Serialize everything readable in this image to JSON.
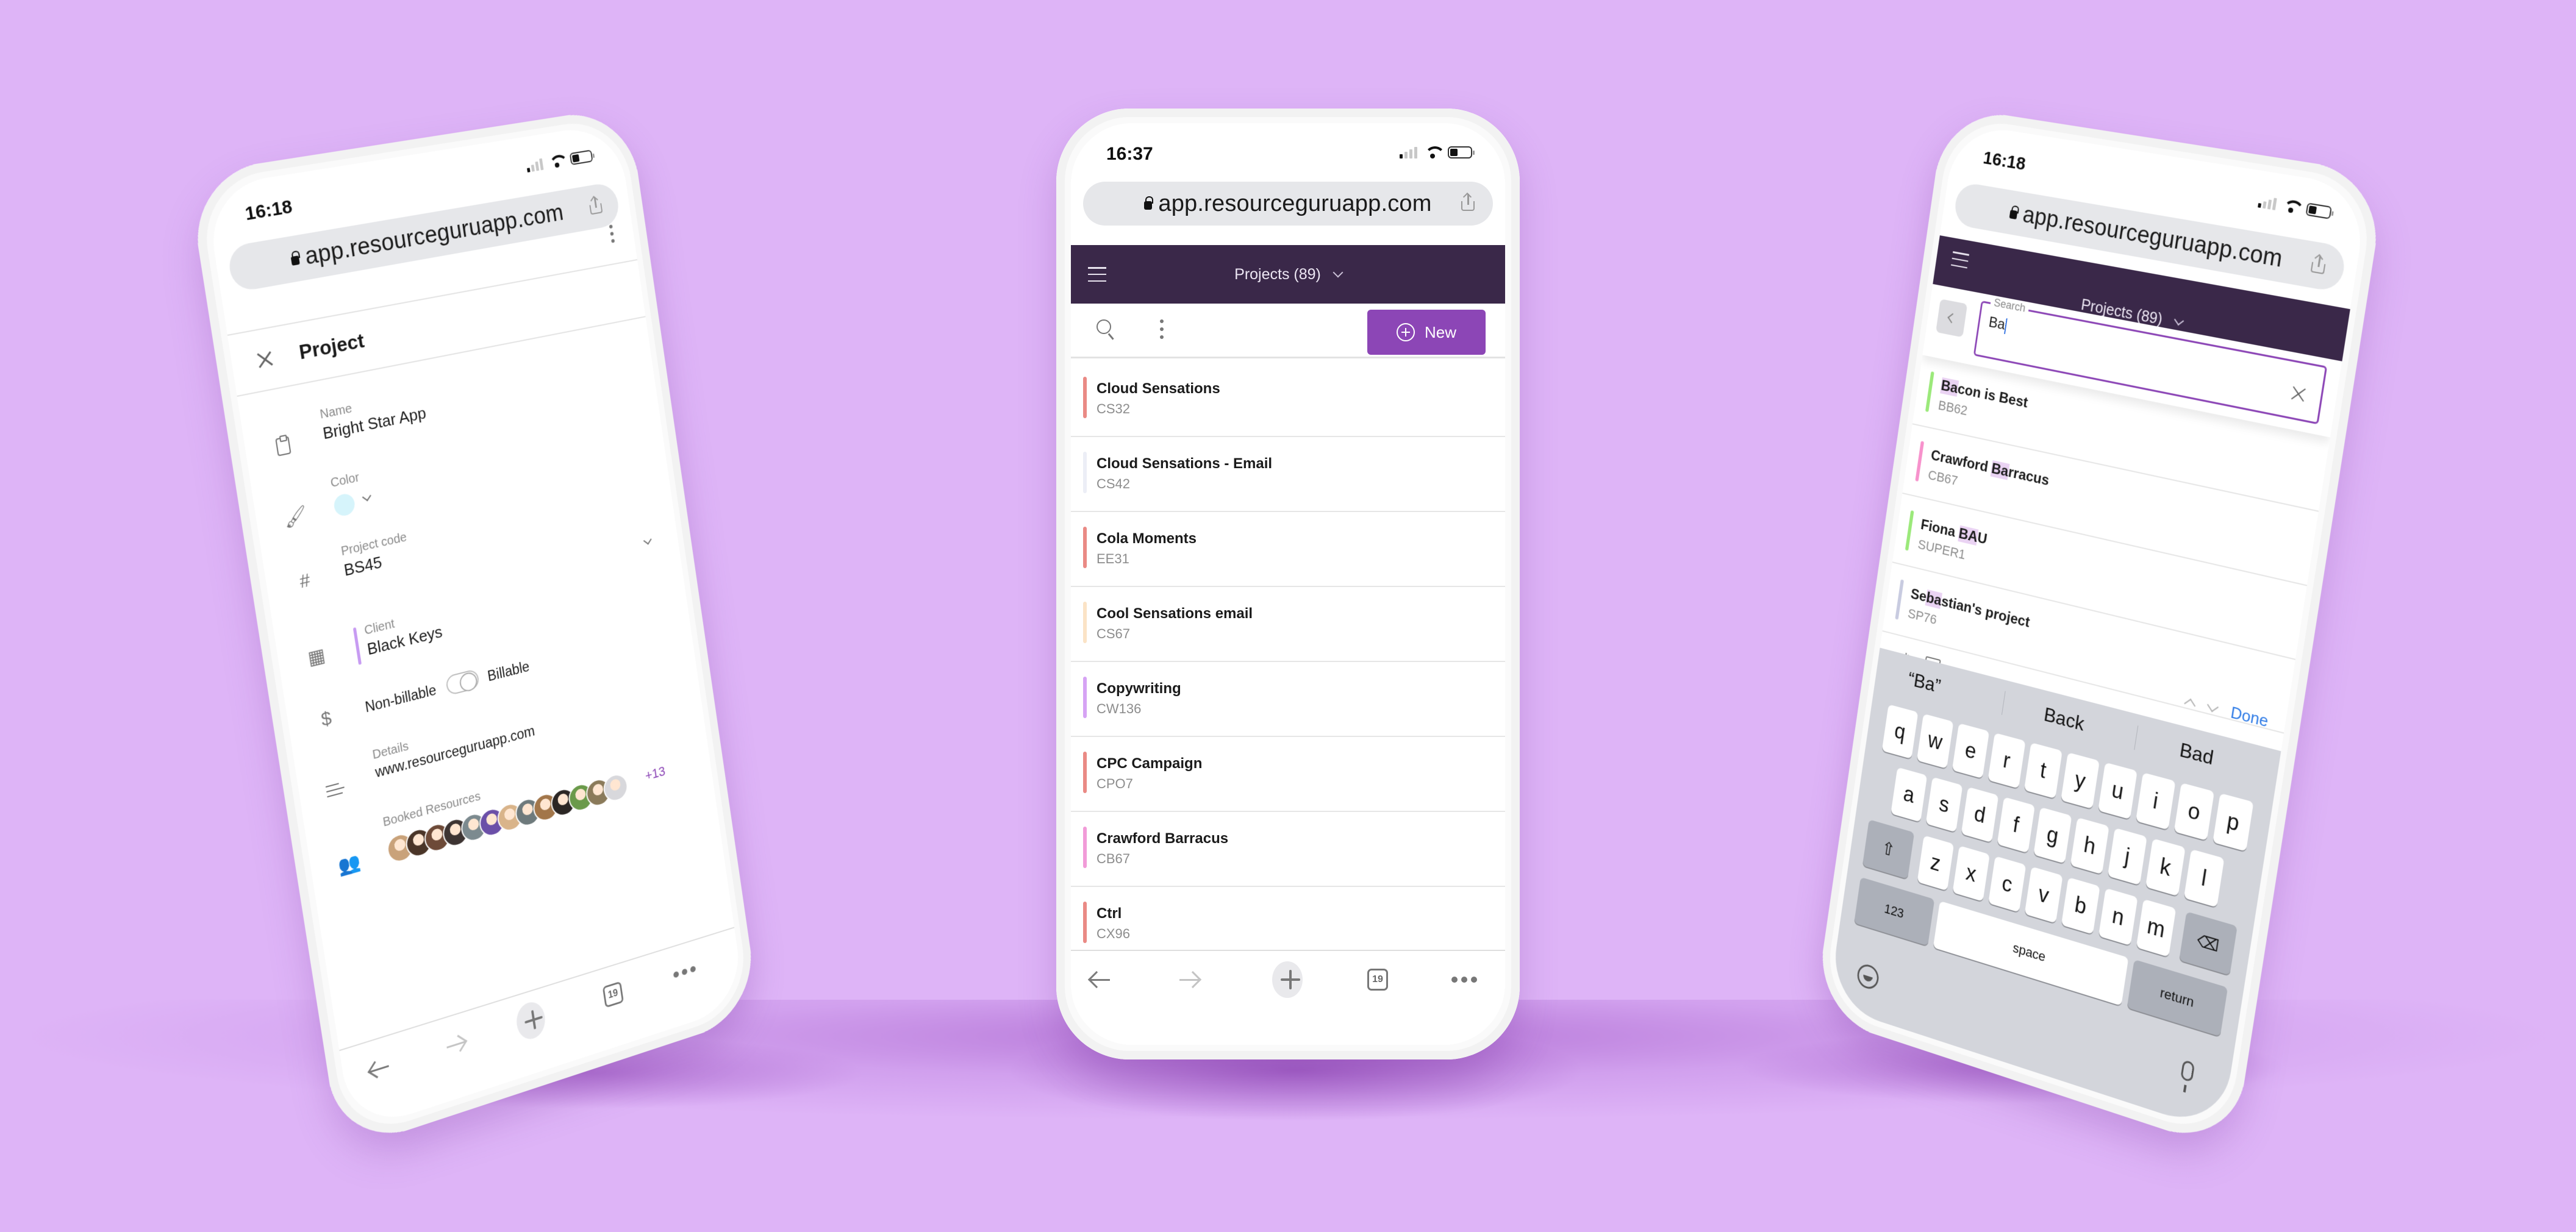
{
  "background_color": "#deb4f7",
  "brand": {
    "header_color": "#3a2849",
    "accent_color": "#8c46b6",
    "highlight_color": "#ead3f3"
  },
  "browser": {
    "url": "app.resourceguruapp.com",
    "tabs_count": "19"
  },
  "left_phone": {
    "time": "16:18",
    "title": "Project",
    "fields": {
      "name_label": "Name",
      "name_value": "Bright Star App",
      "color_label": "Color",
      "color_value": "#d6f4fb",
      "code_label": "Project code",
      "code_value": "BS45",
      "client_label": "Client",
      "client_value": "Black Keys",
      "client_color": "#c79bf2",
      "billing_off_label": "Non-billable",
      "billing_on_label": "Billable",
      "billable": false,
      "details_label": "Details",
      "details_value": "www.resourceguruapp.com",
      "booked_label": "Booked Resources",
      "booked_more": "+13",
      "booked_avatars": [
        "#c9a27a",
        "#4a3528",
        "#6d4a38",
        "#3d3432",
        "#7c8a8f",
        "#6b4fa8",
        "#d9b48a",
        "#6e7a7c",
        "#a2764a",
        "#2b2624",
        "#6a9a4a",
        "#8a7a5a",
        "#d8d8dc"
      ]
    }
  },
  "center_phone": {
    "time": "16:37",
    "header_title": "Projects (89)",
    "new_button": "New",
    "projects": [
      {
        "name": "Cloud Sensations",
        "code": "CS32",
        "color": "#ea8a85"
      },
      {
        "name": "Cloud Sensations - Email",
        "code": "CS42",
        "color": "#eceef6"
      },
      {
        "name": "Cola Moments",
        "code": "EE31",
        "color": "#ea8a85"
      },
      {
        "name": "Cool Sensations email",
        "code": "CS67",
        "color": "#fbe3c6"
      },
      {
        "name": "Copywriting",
        "code": "CW136",
        "color": "#d6a3f4"
      },
      {
        "name": "CPC Campaign",
        "code": "CPO7",
        "color": "#ea8a85"
      },
      {
        "name": "Crawford Barracus",
        "code": "CB67",
        "color": "#f19bd8"
      },
      {
        "name": "Ctrl",
        "code": "CX96",
        "color": "#ea8a85"
      }
    ]
  },
  "right_phone": {
    "time": "16:18",
    "header_title": "Projects (89)",
    "search_label": "Search",
    "search_value": "Ba",
    "results": [
      {
        "pre": "",
        "match": "Ba",
        "post": "con is Best",
        "code": "BB62",
        "color": "#9be97a"
      },
      {
        "pre": "Crawford ",
        "match": "Ba",
        "post": "rracus",
        "code": "CB67",
        "color": "#f792cc"
      },
      {
        "pre": "Fiona ",
        "match": "BA",
        "post": "U",
        "code": "SUPER1",
        "color": "#9be97a"
      },
      {
        "pre": "Se",
        "match": "ba",
        "post": "stian's project",
        "code": "SP76",
        "color": "#c8cbe0"
      }
    ],
    "keyboard": {
      "suggestions": [
        "“Ba”",
        "Back",
        "Bad"
      ],
      "done_label": "Done",
      "row1": [
        "q",
        "w",
        "e",
        "r",
        "t",
        "y",
        "u",
        "i",
        "o",
        "p"
      ],
      "row2": [
        "a",
        "s",
        "d",
        "f",
        "g",
        "h",
        "j",
        "k",
        "l"
      ],
      "row3": [
        "z",
        "x",
        "c",
        "v",
        "b",
        "n",
        "m"
      ],
      "numbers_label": "123",
      "space_label": "space",
      "return_label": "return"
    }
  }
}
